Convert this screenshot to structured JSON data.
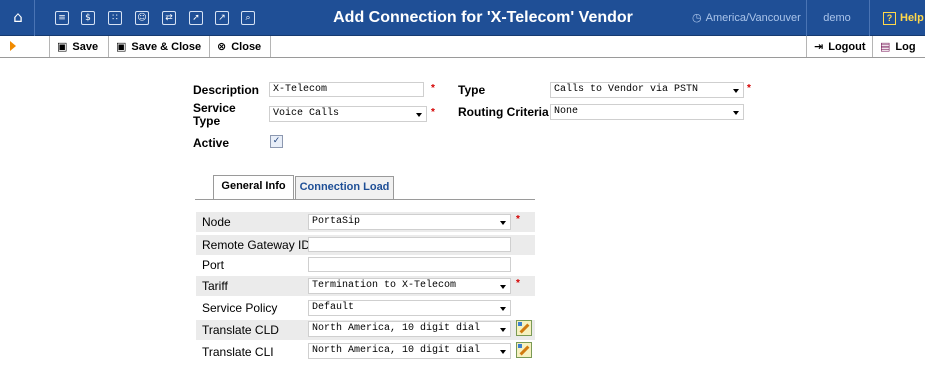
{
  "header": {
    "title": "Add Connection for 'X-Telecom' Vendor",
    "timezone": "America/Vancouver",
    "user": "demo",
    "help_label": "Help",
    "nav_icons": [
      "home-icon",
      "list-icon",
      "dollar-icon",
      "grid-icon",
      "person-icon",
      "switch-icon",
      "export-icon",
      "chart-icon",
      "search-icon"
    ]
  },
  "toolbar": {
    "save_label": "Save",
    "save_close_label": "Save & Close",
    "close_label": "Close",
    "logout_label": "Logout",
    "log_label": "Log"
  },
  "form": {
    "description_label": "Description",
    "description_value": "X-Telecom",
    "type_label": "Type",
    "type_value": "Calls to Vendor via PSTN",
    "service_type_label_1": "Service",
    "service_type_label_2": "Type",
    "service_type_value": "Voice Calls",
    "routing_criteria_label": "Routing Criteria",
    "routing_criteria_value": "None",
    "active_label": "Active",
    "active_checked": true,
    "required_mark": "*"
  },
  "tabs": [
    {
      "label": "General Info",
      "active": true
    },
    {
      "label": "Connection Load",
      "active": false
    }
  ],
  "general_info": {
    "rows": [
      {
        "label": "Node",
        "value": "PortaSip",
        "kind": "select",
        "required": true
      },
      {
        "label": "Remote Gateway ID",
        "value": "",
        "kind": "input",
        "required": false
      },
      {
        "label": "Port",
        "value": "",
        "kind": "input",
        "required": false
      },
      {
        "label": "Tariff",
        "value": "Termination to X-Telecom",
        "kind": "select",
        "required": true
      },
      {
        "label": "Service Policy",
        "value": "Default",
        "kind": "select",
        "required": false
      },
      {
        "label": "Translate CLD",
        "value": "North America, 10 digit dial",
        "kind": "select",
        "required": false
      },
      {
        "label": "Translate CLI",
        "value": "North America, 10 digit dial",
        "kind": "select",
        "required": false
      }
    ]
  }
}
